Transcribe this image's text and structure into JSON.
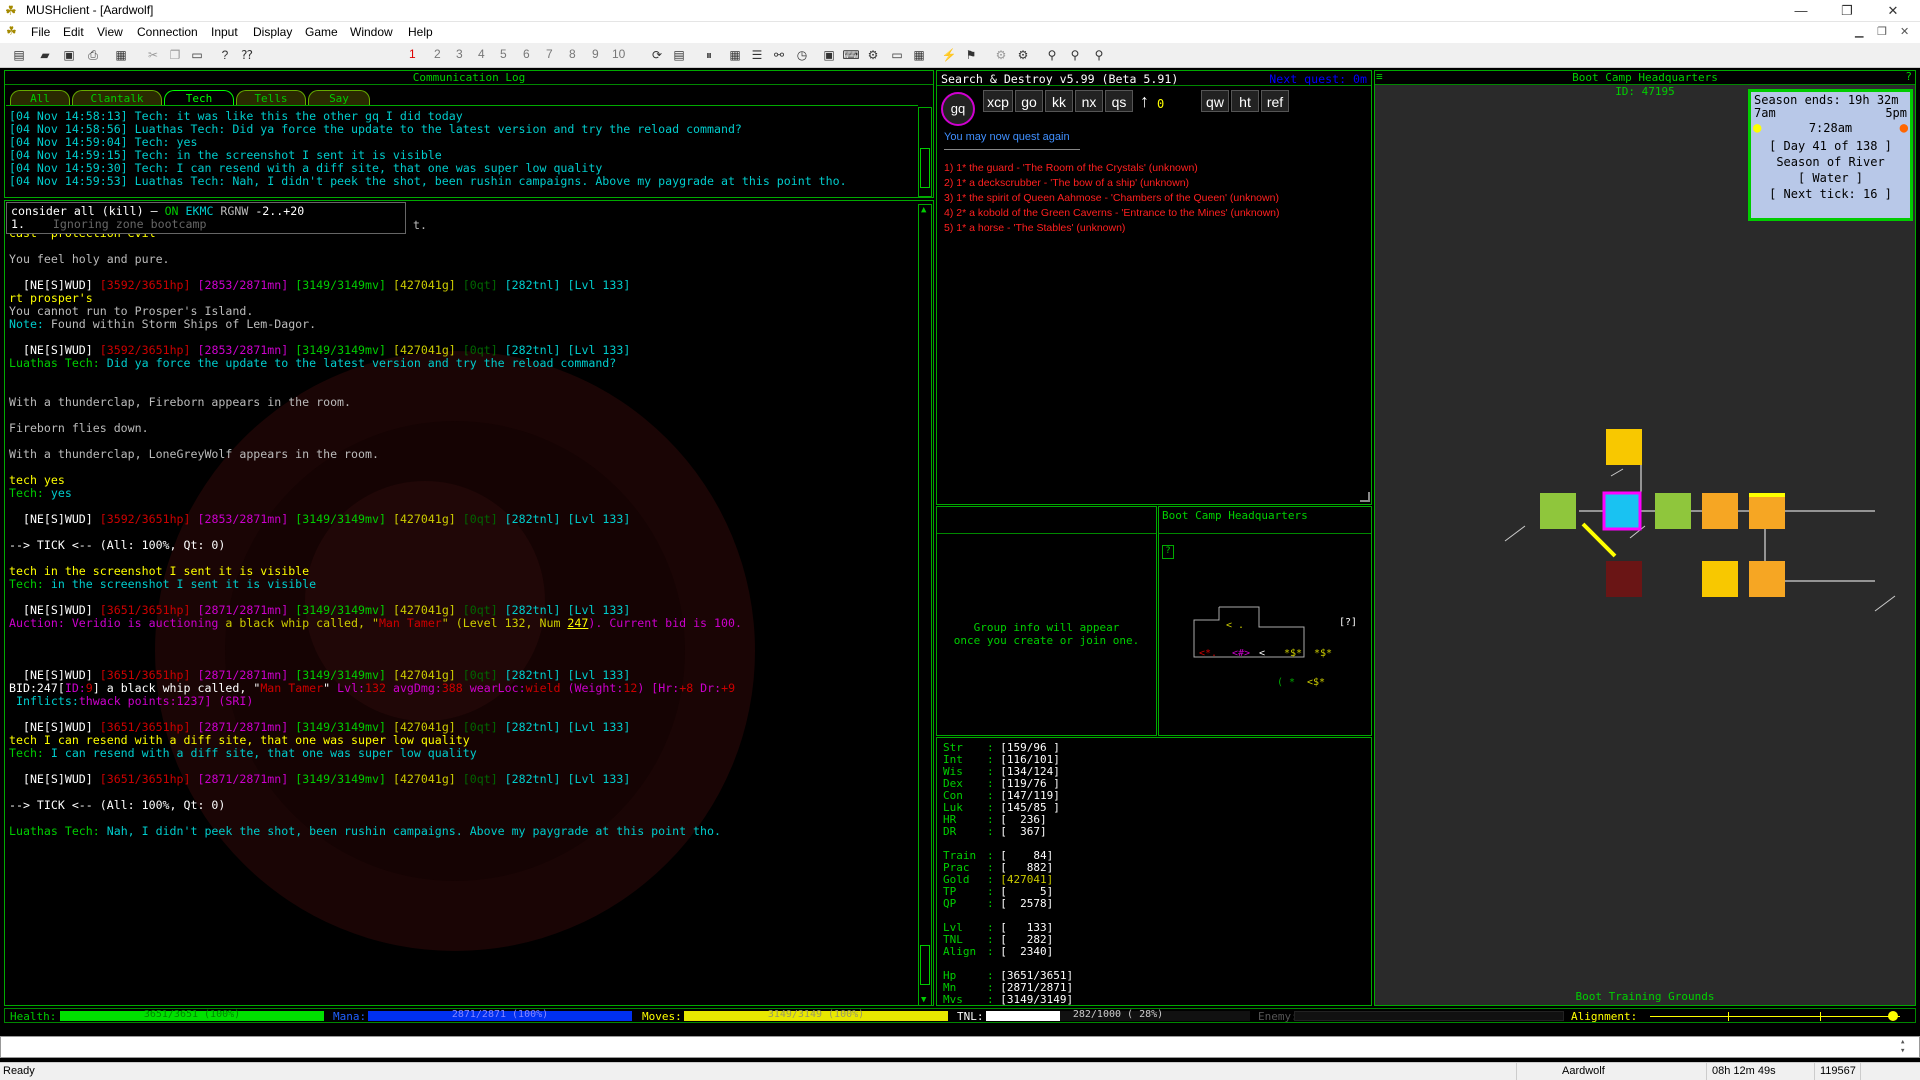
{
  "window": {
    "title": "MUSHclient - [Aardwolf]",
    "min": "—",
    "max": "❐",
    "close": "✕"
  },
  "menu": [
    "File",
    "Edit",
    "View",
    "Connection",
    "Input",
    "Display",
    "Game",
    "Window",
    "Help"
  ],
  "toolbar_nums": [
    "1",
    "2",
    "3",
    "4",
    "5",
    "6",
    "7",
    "8",
    "9",
    "10"
  ],
  "commlog": {
    "title": "Communication Log",
    "tabs": [
      "All",
      "Clantalk",
      "Tech",
      "Tells",
      "Say"
    ],
    "lines": [
      "[04 Nov 14:58:13] Tech: it was like this the other gq I did today",
      "[04 Nov 14:58:56] Luathas Tech: Did ya force the update to the latest version and try the reload command?",
      "[04 Nov 14:59:04] Tech: yes",
      "[04 Nov 14:59:15] Tech: in the screenshot I sent it is visible",
      "[04 Nov 14:59:30] Tech: I can resend with a diff site, that one was super low quality",
      "[04 Nov 14:59:53] Luathas Tech: Nah, I didn't peek the shot, been rushin campaigns. Above my paygrade at this point tho."
    ]
  },
  "consider": {
    "cmd": "consider all (kill) – ",
    "on": "ON",
    "ekmc": "EKMC",
    "rgnw": "RGNW",
    "range": "-2..+20",
    "line2_num": "1.",
    "line2_text": "Ignoring zone bootcamp",
    "tail": "t."
  },
  "prompt": {
    "a": "[NE[S]WUD]",
    "hp1": "[3592/3651hp]",
    "mn1": "[2853/2871mn]",
    "hp2": "[3651/3651hp]",
    "mn2": "[2871/2871mn]",
    "mv": "[3149/3149mv]",
    "gold": "[427041g]",
    "qt": "[0qt]",
    "tnl": "[282tnl]",
    "lvl": "[Lvl 133]"
  },
  "main": {
    "l1": "cast 'protection evil'",
    "l2": "You feel holy and pure.",
    "l3": "rt prosper's",
    "l4": "You cannot run to Prosper's Island.",
    "l5a": "Note:",
    "l5b": " Found within Storm Ships of Lem-Dagor.",
    "l6a": "Luathas Tech:",
    "l6b": " Did ya force the update to the latest version and try the reload command?",
    "l7": "With a thunderclap, Fireborn appears in the room.",
    "l8": "Fireborn flies down.",
    "l9": "With a thunderclap, LoneGreyWolf appears in the room.",
    "l10": "tech yes",
    "l11a": "Tech:",
    "l11b": " yes",
    "tick": "--> TICK <-- (All: 100%, Qt: 0)",
    "l12": "tech in the screenshot I sent it is visible",
    "l13a": "Tech:",
    "l13b": " in the screenshot I sent it is visible",
    "auc1": "Auction:",
    "auc2": " Veridio is auctioning",
    "auc3": " a black whip called, \"",
    "auc4": "Man Tamer",
    "auc5": "\" (Level 132, Num ",
    "auc6": "247",
    "auc7": "). Current bid is 100.",
    "bid1": "BID:247[",
    "bid2": "ID:",
    "bid3": "9",
    "bid4": "] a black whip called, \"",
    "bid5": "Man Tamer",
    "bid6": "\" ",
    "bid7": "Lvl:",
    "bid8": "132",
    "bid9": " avgDmg:",
    "bid10": "388",
    "bid11": " wearLoc:",
    "bid12": "wield",
    "bid13": " (Weight:",
    "bid14": "12",
    "bid15": ") [",
    "bid16": "Hr:",
    "bid17": "+8",
    "bid18": " Dr:",
    "bid19": "+9",
    "inf1": " Inflicts:",
    "inf2": "thwack",
    "inf3": " points:",
    "inf4": "1237",
    "inf5": "] (SRI)",
    "l14": "tech I can resend with a diff site, that one was super low quality",
    "l15a": "Tech:",
    "l15b": " I can resend with a diff site, that one was super low quality",
    "l16a": "Luathas Tech:",
    "l16b": " Nah, I didn't peek the shot, been rushin campaigns. Above my paygrade at this point tho."
  },
  "snd": {
    "title": "Search & Destroy v5.99 (Beta 5.91)",
    "next": "Next quest: 0m",
    "gq": "gq",
    "btns": [
      "xcp",
      "go",
      "kk",
      "nx",
      "qs"
    ],
    "arrow_count": "0",
    "btns2": [
      "qw",
      "ht",
      "ref"
    ],
    "msg": "You may now quest again",
    "targets": [
      "1) 1* the guard - 'The Room of the Crystals' (unknown)",
      "2) 1* a deckscrubber - 'The bow of a ship' (unknown)",
      "3) 1* the spirit of Queen Aahmose - 'Chambers of the Queen' (unknown)",
      "4) 2* a kobold of the Green Caverns - 'Entrance to the Mines' (unknown)",
      "5) 1* a horse - 'The Stables' (unknown)"
    ]
  },
  "group": {
    "l1": "Group info will appear",
    "l2": "once you create or join one."
  },
  "minimap": {
    "title": "Boot Camp Headquarters",
    "q": "?",
    "qm": "[?]"
  },
  "stats": {
    "rows": [
      [
        "Str",
        "[159/96 ]"
      ],
      [
        "Int",
        "[116/101]"
      ],
      [
        "Wis",
        "[134/124]"
      ],
      [
        "Dex",
        "[119/76 ]"
      ],
      [
        "Con",
        "[147/119]"
      ],
      [
        "Luk",
        "[145/85 ]"
      ],
      [
        "HR",
        "[  236]"
      ],
      [
        "DR",
        "[  367]"
      ]
    ],
    "rows2": [
      [
        "Train",
        "[    84]"
      ],
      [
        "Prac",
        "[   882]"
      ],
      [
        "Gold",
        "[427041]"
      ],
      [
        "TP",
        "[     5]"
      ],
      [
        "QP",
        "[  2578]"
      ]
    ],
    "rows3": [
      [
        "Lvl",
        "[   133]"
      ],
      [
        "TNL",
        "[   282]"
      ],
      [
        "Align",
        "[  2340]"
      ]
    ],
    "rows4": [
      [
        "Hp",
        "[3651/3651]"
      ],
      [
        "Mn",
        "[2871/2871]"
      ],
      [
        "Mvs",
        "[3149/3149]"
      ]
    ]
  },
  "map": {
    "title": "Boot Camp Headquarters",
    "id": "ID: 47195",
    "footer": "Boot Training Grounds",
    "corner_left": "≡",
    "corner_right": "?"
  },
  "clock": {
    "season_ends": "Season ends: 19h 32m",
    "am": "7am",
    "pm": "5pm",
    "time": "7:28am",
    "day": "[ Day  41 of 138 ]",
    "season": "Season of River",
    "element": "[ Water ]",
    "tick": "[ Next tick: 16 ]"
  },
  "bars": {
    "health_label": "Health:",
    "health_text": "3651/3651 (100%)",
    "health_pct": 100,
    "mana_label": "Mana:",
    "mana_text": "2871/2871 (100%)",
    "mana_pct": 100,
    "moves_label": "Moves:",
    "moves_text": "3149/3149 (100%)",
    "moves_pct": 100,
    "tnl_label": "TNL:",
    "tnl_text": "282/1000 ( 28%)",
    "tnl_pct": 28,
    "enemy_label": "Enemy:",
    "align_label": "Alignment:"
  },
  "status": {
    "ready": "Ready",
    "world": "Aardwolf",
    "time": "08h 12m 49s",
    "num": "119567"
  },
  "colors": {
    "accent": "#00d000",
    "health": "#00e000",
    "mana": "#0030f0",
    "moves": "#e8e800",
    "tnl": "#ffffff"
  }
}
